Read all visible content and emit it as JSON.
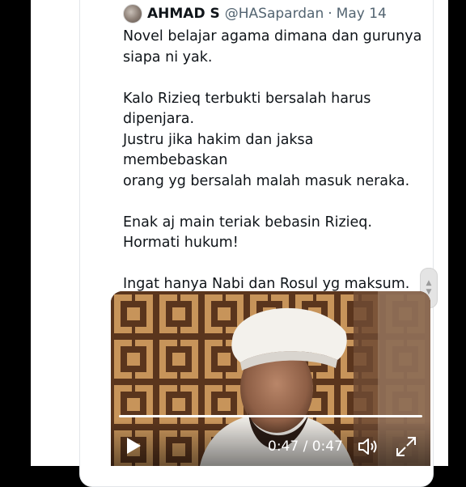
{
  "tweet": {
    "author_name": "AHMAD S",
    "handle": "@HASapardan",
    "separator": "·",
    "date": "May 14",
    "lines": [
      "Novel belajar agama dimana dan gurunya",
      "siapa ni yak.",
      "",
      "Kalo Rizieq terbukti bersalah harus",
      "dipenjara.",
      "Justru jika hakim dan jaksa membebaskan",
      "orang yg bersalah malah masuk neraka.",
      "",
      "Enak aj main teriak bebasin Rizieq.",
      "Hormati hukum!",
      "",
      "Ingat hanya Nabi dan Rosul yg maksum."
    ]
  },
  "video": {
    "time_display": "0:47 / 0:47",
    "progress_fraction": 1.0
  },
  "icons": {
    "play": "play-icon",
    "volume": "volume-icon",
    "fullscreen": "expand-icon",
    "scroll": "scroll-arrows-icon"
  }
}
